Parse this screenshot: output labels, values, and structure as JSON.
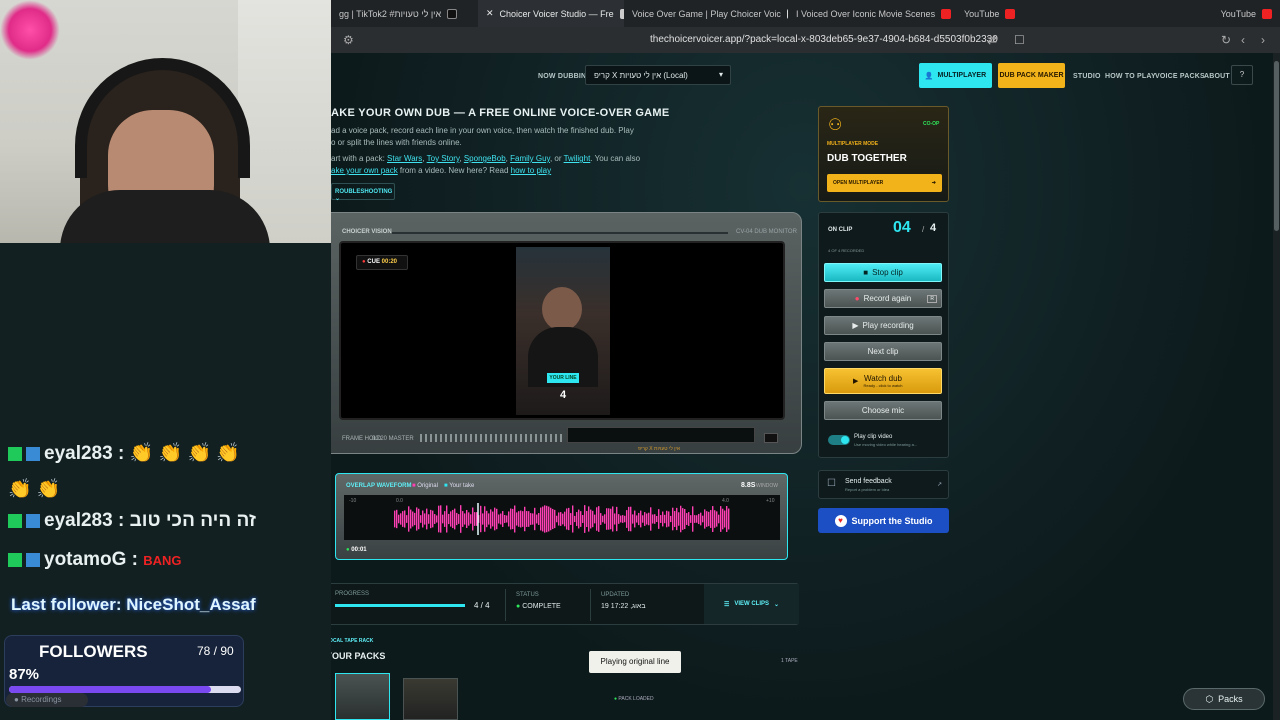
{
  "browser": {
    "tabs": [
      {
        "label": "gg | TikTokאין לי טעויות# 2",
        "active": false
      },
      {
        "label": "Choicer Voicer Studio — Fre",
        "active": true
      },
      {
        "label": "Voice Over Game | Play Choicer Voic",
        "active": false
      },
      {
        "label": "I Voiced Over Iconic Movie Scenes",
        "active": false
      },
      {
        "label": "YouTube",
        "active": false
      },
      {
        "label": "YouTube",
        "active": false
      }
    ],
    "url": "thechoicervoicer.app/?pack=local-x-803deb65-9e37-4904-b684-d5503f0b2330"
  },
  "header": {
    "now_dubbing_label": "NOW DUBBING",
    "pack_select": "קריפ X אין לי טעויות (Local)",
    "multiplayer": "MULTIPLAYER",
    "dub_pack_maker": "DUB PACK MAKER",
    "nav": [
      "STUDIO",
      "HOW TO PLAY",
      "VOICE PACKS",
      "ABOUT"
    ],
    "help": "?"
  },
  "hero": {
    "title": "AKE YOUR OWN DUB — A FREE ONLINE VOICE-OVER GAME",
    "line1": "ad a voice pack, record each line in your own voice, then watch the finished dub. Play",
    "line2": "o or split the lines with friends online.",
    "line3_prefix": "art with a pack:",
    "packs": [
      "Star Wars",
      "Toy Story",
      "SpongeBob",
      "Family Guy",
      "Twilight"
    ],
    "or": ", or",
    "line3_suffix": ". You can also",
    "line4_link": "ake your own pack",
    "line4_mid": " from a video. New here? Read ",
    "line4_link2": "how to play",
    "troubleshoot": "ROUBLESHOOTING"
  },
  "monitor": {
    "brand": "CHOICER VISION",
    "model": "CV-04 DUB MONITOR",
    "cue_label": "CUE",
    "cue_time": "00:20",
    "your_line": "YOUR LINE",
    "clip_number": "4",
    "frame_label": "FRAME HOLD",
    "master_label": "00:20 MASTER",
    "caption": "קריפ X אין לי טעויות"
  },
  "waveform": {
    "label": "OVERLAP WAVEFORM",
    "legend_original": "Original",
    "legend_take": "Your take",
    "duration": "8.8S",
    "window": "WINDOW",
    "time": "00:01",
    "tick_left": "-10",
    "tick_mid": "0.0",
    "tick_right": "+10",
    "tick_right2": "4.0"
  },
  "stats": {
    "progress_label": "PROGRESS",
    "progress_value": "4 / 4",
    "progress_fraction": 1.0,
    "status_label": "STATUS",
    "status_value": "COMPLETE",
    "updated_label": "UPDATED",
    "updated_value": "19 17:22 ,באוג",
    "view_clips": "VIEW CLIPS"
  },
  "packs": {
    "rack_label": "LOCAL TAPE RACK",
    "title": "YOUR PACKS",
    "count": "1 TAPE",
    "toast": "Playing original line",
    "pack_loaded": "PACK LOADED",
    "packs_button": "Packs"
  },
  "multiplayer_card": {
    "mode": "MULTIPLAYER MODE",
    "badge": "CO-OP",
    "title": "DUB TOGETHER",
    "button": "OPEN MULTIPLAYER"
  },
  "controls": {
    "on_clip": "ON CLIP",
    "current": "04",
    "sep": "/",
    "total": "4",
    "recorded": "4 OF 4 RECORDED",
    "stop_clip": "Stop clip",
    "record_again": "Record again",
    "record_key": "R",
    "play_recording": "Play recording",
    "next_clip": "Next clip",
    "watch_dub": "Watch dub",
    "watch_dub_sub": "Ready - click to watch",
    "choose_mic": "Choose mic",
    "play_clip_video": "Play clip video",
    "play_clip_video_sub": "Use moving video while hearing a...",
    "feedback": "Send feedback",
    "feedback_sub": "Report a problem or idea",
    "support": "Support the Studio"
  },
  "stream_overlay": {
    "chat": [
      {
        "user": "eyal283",
        "text": "👏 👏 👏 👏"
      },
      {
        "user": "",
        "text": "👏 👏"
      },
      {
        "user": "eyal283",
        "text": "זה היה הכי טוב"
      },
      {
        "user": "yotamoG",
        "text": "BANG"
      }
    ],
    "last_follower": "Last follower: NiceShot_Assaf",
    "followers_label": "FOLLOWERS",
    "followers_count": "78 / 90",
    "followers_percent": "87%",
    "followers_fraction": 0.87,
    "recordings": "Recordings"
  },
  "colors": {
    "accent_cyan": "#2ee6f0",
    "accent_gold": "#f2b21a",
    "waveform_pink": "#ff3fb4",
    "support_blue": "#1d4fc4"
  }
}
